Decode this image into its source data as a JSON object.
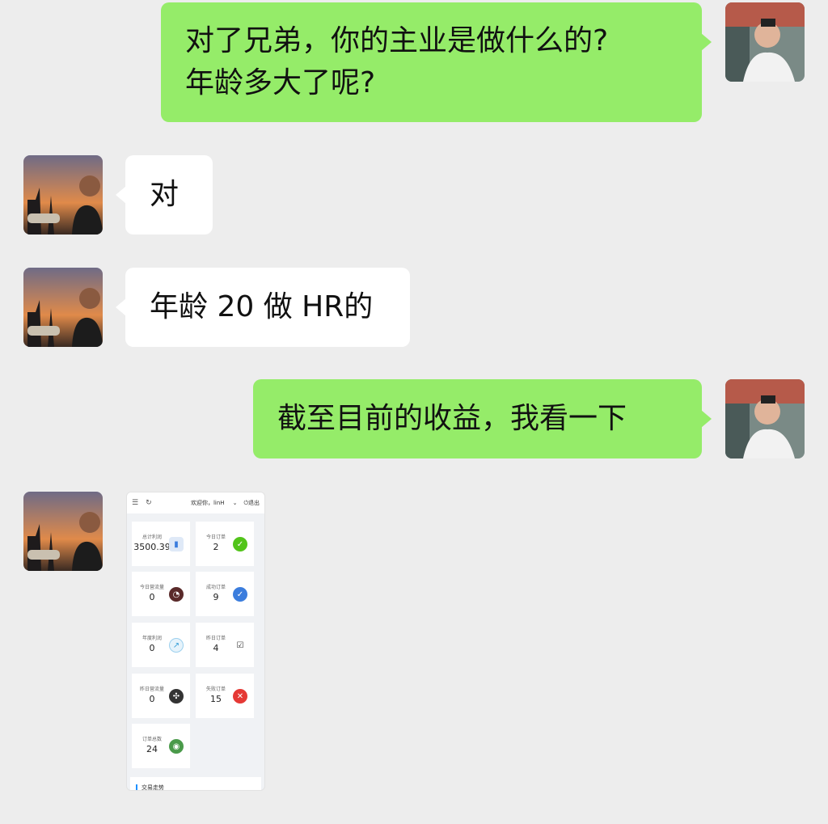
{
  "messages": [
    {
      "side": "right",
      "lines": [
        "对了兄弟，你的主业是做什么的?",
        "年龄多大了呢?"
      ]
    },
    {
      "side": "left",
      "lines": [
        "对"
      ]
    },
    {
      "side": "left",
      "lines": [
        "年龄 20 做 HR的"
      ]
    },
    {
      "side": "right",
      "lines": [
        "截至目前的收益，我看一下"
      ]
    }
  ],
  "screenshot": {
    "welcome": "欢迎你，linH",
    "logout": "退出",
    "cards": [
      {
        "label": "总计利润",
        "value": "3500.39",
        "icon": "bar-chart-icon",
        "color": "#dfe9f7"
      },
      {
        "label": "今日订单",
        "value": "2",
        "icon": "check-circle-icon",
        "color": "#52c41a"
      },
      {
        "label": "今日营流量",
        "value": "0",
        "icon": "gauge-icon",
        "color": "#5a2a2a"
      },
      {
        "label": "成功订单",
        "value": "9",
        "icon": "verified-badge-icon",
        "color": "#3b7ddd"
      },
      {
        "label": "年度利润",
        "value": "0",
        "icon": "trend-chart-icon",
        "color": "#e6f3fb"
      },
      {
        "label": "昨日订单",
        "value": "4",
        "icon": "clipboard-check-icon",
        "color": "#ffffff"
      },
      {
        "label": "昨日营流量",
        "value": "0",
        "icon": "lifebuoy-icon",
        "color": "#333333"
      },
      {
        "label": "失败订单",
        "value": "15",
        "icon": "cross-circle-icon",
        "color": "#e53935"
      },
      {
        "label": "订单总数",
        "value": "24",
        "icon": "chrome-icon",
        "color": "#4a9a4a"
      }
    ],
    "bottom_title": "交易走势"
  },
  "colors": {
    "background": "#ededed",
    "sent_bubble": "#95ec69",
    "received_bubble": "#ffffff"
  }
}
